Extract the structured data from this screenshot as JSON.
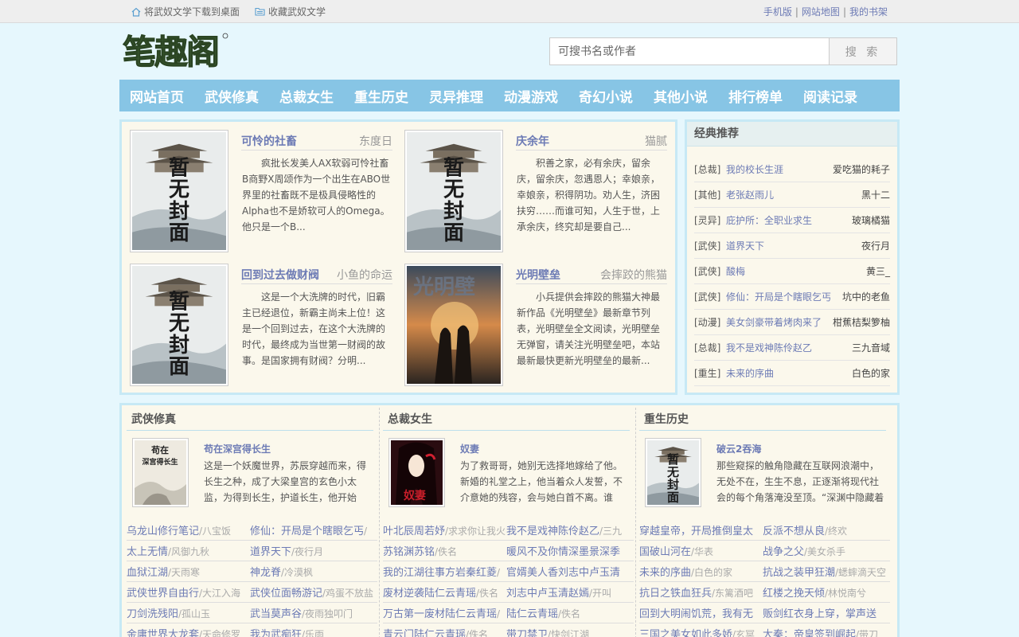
{
  "topbar": {
    "left": [
      {
        "label": "将武奴文学下载到桌面",
        "icon": "home-icon"
      },
      {
        "label": "收藏武奴文学",
        "icon": "folder-icon"
      }
    ],
    "right": [
      "手机版",
      "网站地图",
      "我的书架"
    ],
    "sep": "|"
  },
  "logo": {
    "text": "笔趣阁"
  },
  "search": {
    "placeholder": "可搜书名或作者",
    "button": "搜 索"
  },
  "nav": [
    "网站首页",
    "武侠修真",
    "总裁女生",
    "重生历史",
    "灵异推理",
    "动漫游戏",
    "奇幻小说",
    "其他小说",
    "排行榜单",
    "阅读记录"
  ],
  "hot": [
    {
      "title": "可怜的社畜",
      "author": "东度日",
      "desc": "疯批长发美人AX软弱可怜社畜B商野X周颂作为一个出生在ABO世界里的社畜既不是极具侵略性的Alpha也不是娇软可人的Omega。他只是一个B...",
      "cover": "no-cover"
    },
    {
      "title": "庆余年",
      "author": "猫腻",
      "desc": "积善之家，必有余庆，留余庆，留余庆，忽遇恩人；幸娘亲，幸娘亲，积得阴功。劝人生，济困扶穷……而谁可知，人生于世，上承余庆，终究却是要自己...",
      "cover": "no-cover"
    },
    {
      "title": "回到过去做财阀",
      "author": "小鱼的命运",
      "desc": "这是一个大洗牌的时代，旧霸主已经退位，新霸主尚未上位！这是一个回到过去，在这个大洗牌的时代，最终成为当世第一财阀的故事。是国家拥有财阀？分明...",
      "cover": "no-cover"
    },
    {
      "title": "光明壁垒",
      "author": "会摔跤的熊猫",
      "desc": "小兵提供会摔跤的熊猫大神最新作品《光明壁垒》最新章节列表，光明壁垒全文阅读，光明壁垒无弹窗，请关注光明壁垒吧，本站最新最快更新光明壁垒的最新...",
      "cover": "art"
    }
  ],
  "no_cover_text": "暂无封面",
  "classic": {
    "title": "经典推荐",
    "items": [
      {
        "cat": "[总裁]",
        "title": "我的校长生涯",
        "author": "爱吃猫的耗子"
      },
      {
        "cat": "[其他]",
        "title": "老张赵雨儿",
        "author": "黑十二"
      },
      {
        "cat": "[灵异]",
        "title": "庇护所：全职业求生",
        "author": "玻璃橘猫"
      },
      {
        "cat": "[武侠]",
        "title": "道界天下",
        "author": "夜行月"
      },
      {
        "cat": "[武侠]",
        "title": "酸梅",
        "author": "黄三_"
      },
      {
        "cat": "[武侠]",
        "title": "修仙：开局是个瞎眼乞丐",
        "author": "坑中的老鱼"
      },
      {
        "cat": "[动漫]",
        "title": "美女剑豪带着烤肉来了",
        "author": "柑蕉桔梨箩柚"
      },
      {
        "cat": "[总裁]",
        "title": "我不是戏神陈伶赵乙",
        "author": "三九音域"
      },
      {
        "cat": "[重生]",
        "title": "未来的序曲",
        "author": "白色的家"
      }
    ]
  },
  "categories": [
    {
      "title": "武侠修真",
      "feat": {
        "title": "苟在深宫得长生",
        "desc": "这是一个妖魔世界，苏辰穿越而来，得长生之种，成了大梁皇宫的玄色小太监，为得到长生，护道长生，他开始了......",
        "cover_text": "苟在深宫得长生"
      },
      "rows": [
        [
          {
            "b": "乌龙山修行笔记",
            "a": "/八宝饭"
          },
          {
            "b": "修仙：开局是个瞎眼乞丐",
            "a": "/"
          }
        ],
        [
          {
            "b": "太上无情",
            "a": "/风御九秋"
          },
          {
            "b": "道界天下",
            "a": "/夜行月"
          }
        ],
        [
          {
            "b": "血狱江湖",
            "a": "/天雨寒"
          },
          {
            "b": "神龙脊",
            "a": "/冷漠枫"
          }
        ],
        [
          {
            "b": "武侠世界自由行",
            "a": "/大江入海"
          },
          {
            "b": "武侠位面畅游记",
            "a": "/鸡蛋不放盐"
          }
        ],
        [
          {
            "b": "刀剑洗残阳",
            "a": "/孤山玉"
          },
          {
            "b": "武当莫声谷",
            "a": "/夜雨独叩门"
          }
        ],
        [
          {
            "b": "金庸世界大龙套",
            "a": "/天命修罗"
          },
          {
            "b": "我为武痴狂",
            "a": "/乐雨"
          }
        ]
      ]
    },
    {
      "title": "总裁女生",
      "feat": {
        "title": "奴妻",
        "desc": "为了救哥哥，她别无选择地嫁给了他。新婚的礼堂之上，他当着众人发誓，不介意她的残容，会与她白首不离。谁料，洞房",
        "cover_text": "奴妻"
      },
      "rows": [
        [
          {
            "b": "叶北辰周若妤",
            "a": "/求求你让我火"
          },
          {
            "b": "我不是戏神陈伶赵乙",
            "a": "/三九"
          }
        ],
        [
          {
            "b": "苏铭渊苏铭",
            "a": "/佚名"
          },
          {
            "b": "暖风不及你情深墨景深季",
            "a": ""
          }
        ],
        [
          {
            "b": "我的江湖往事方岩秦红菱",
            "a": "/"
          },
          {
            "b": "官婿美人香刘志中卢玉清",
            "a": ""
          }
        ],
        [
          {
            "b": "废材逆袭陆仁云青瑶",
            "a": "/佚名"
          },
          {
            "b": "刘志中卢玉清赵嫣",
            "a": "/开叫"
          }
        ],
        [
          {
            "b": "万古第一废材陆仁云青瑶",
            "a": "/"
          },
          {
            "b": "陆仁云青瑶",
            "a": "/佚名"
          }
        ],
        [
          {
            "b": "青云门陆仁云青瑶",
            "a": "/佚名"
          },
          {
            "b": "带刀禁卫",
            "a": "/快剑江湖"
          }
        ]
      ]
    },
    {
      "title": "重生历史",
      "feat": {
        "title": "破云2吞海",
        "desc": "那些窥探的触角隐藏在互联网浪潮中，无处不在，生生不息，正逐渐将现代社会的每个角落淹没至顶。“深渊中隐藏着庞",
        "cover_text": "暂无封面"
      },
      "rows": [
        [
          {
            "b": "穿越皇帝，开局推倒皇太",
            "a": ""
          },
          {
            "b": "反派不想从良",
            "a": "/终欢"
          }
        ],
        [
          {
            "b": "国破山河在",
            "a": "/华表"
          },
          {
            "b": "战争之父",
            "a": "/美女杀手"
          }
        ],
        [
          {
            "b": "未来的序曲",
            "a": "/白色的家"
          },
          {
            "b": "抗战之装甲狂潮",
            "a": "/蟋蟀滴天空"
          }
        ],
        [
          {
            "b": "抗日之铁血狂兵",
            "a": "/东篱酒吧"
          },
          {
            "b": "红楼之挽天倾",
            "a": "/林悦南兮"
          }
        ],
        [
          {
            "b": "回到大明闹饥荒，我有无",
            "a": ""
          },
          {
            "b": "贩剑红衣身上穿，掌声送",
            "a": ""
          }
        ],
        [
          {
            "b": "三国之美女如此多娇",
            "a": "/玄冥"
          },
          {
            "b": "大秦：帝皇签到崛起",
            "a": "/带刀"
          }
        ]
      ]
    }
  ],
  "colors": {
    "nav": "#87c5e5",
    "link": "#6d7bb5",
    "bg": "#e6f7fd",
    "panel": "#fbf8ec",
    "border": "#c7e9f5"
  }
}
